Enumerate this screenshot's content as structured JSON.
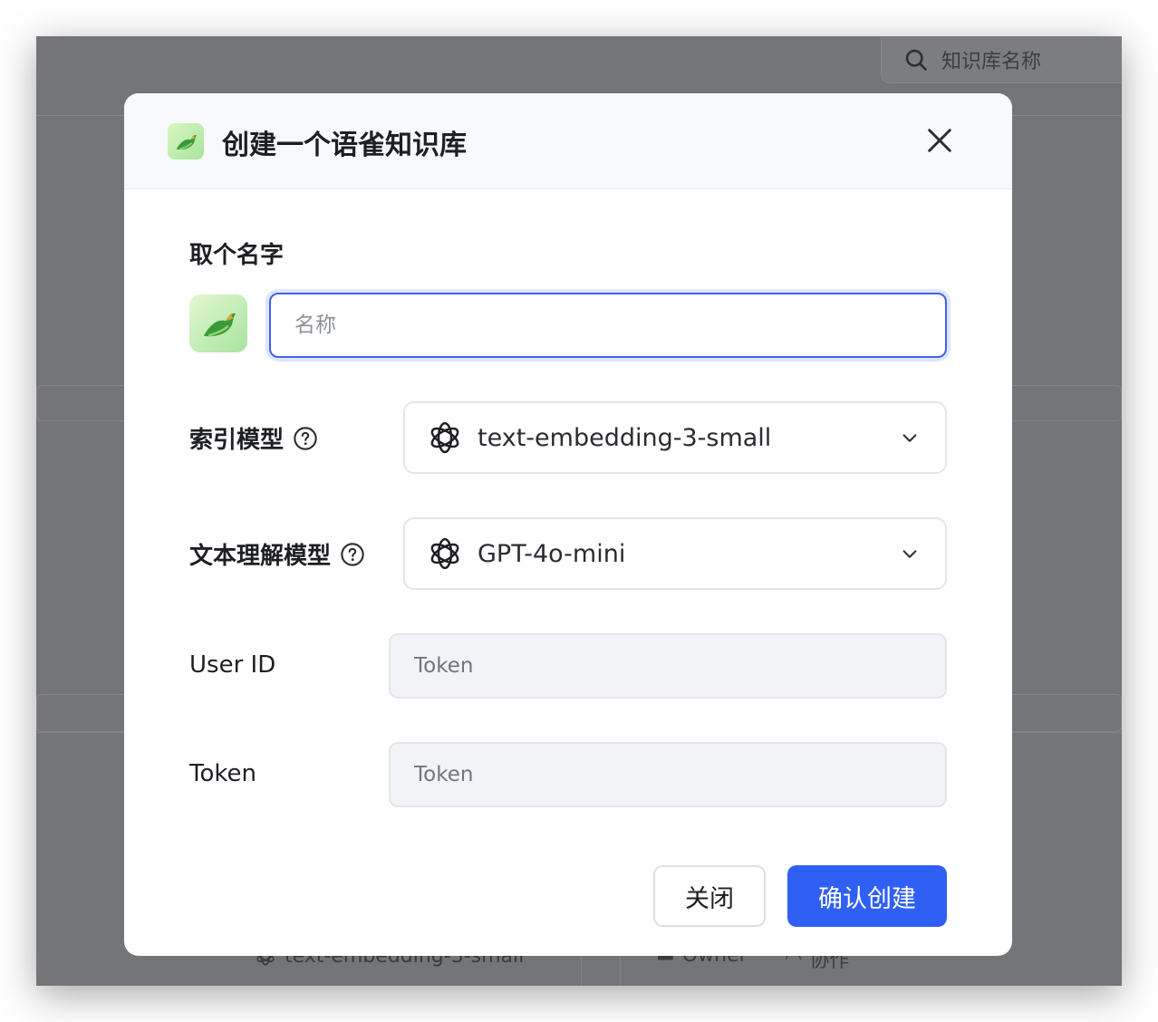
{
  "background": {
    "search_placeholder": "知识库名称",
    "bottom_model": "text-embedding-3-small",
    "bottom_owner": "Owner",
    "bottom_collab": "协作"
  },
  "modal": {
    "title": "创建一个语雀知识库",
    "name_section": {
      "label": "取个名字",
      "placeholder": "名称",
      "value": ""
    },
    "index_model": {
      "label": "索引模型",
      "value": "text-embedding-3-small"
    },
    "text_model": {
      "label": "文本理解模型",
      "value": "GPT-4o-mini"
    },
    "user_id": {
      "label": "User ID",
      "placeholder": "Token"
    },
    "token": {
      "label": "Token",
      "placeholder": "Token"
    },
    "buttons": {
      "close": "关闭",
      "confirm": "确认创建"
    }
  },
  "colors": {
    "primary": "#2f5ff5",
    "overlay": "#747578",
    "focus_border": "#3b63f0"
  },
  "icons": [
    "search-icon",
    "yuque-bird-icon",
    "close-icon",
    "help-circle-icon",
    "openai-icon",
    "chevron-down-icon"
  ]
}
